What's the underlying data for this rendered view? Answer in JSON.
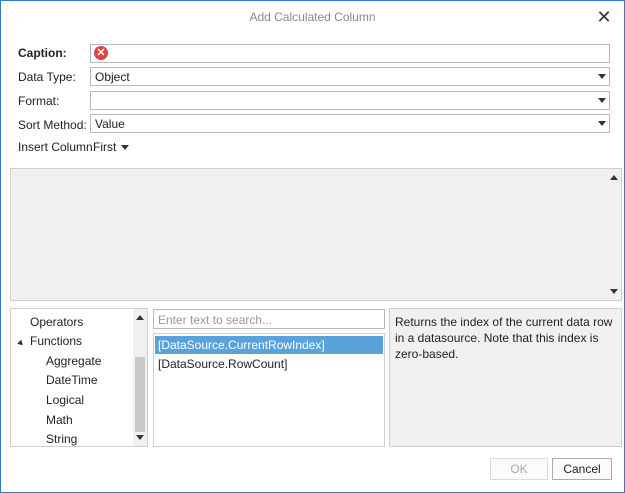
{
  "dialog": {
    "title": "Add Calculated Column",
    "close_glyph": "✕"
  },
  "form": {
    "caption_label": "Caption:",
    "caption_error_icon": "error-icon",
    "datatype_label": "Data Type:",
    "datatype_value": "Object",
    "format_label": "Format:",
    "format_value": "",
    "sort_label": "Sort Method:",
    "sort_value": "Value",
    "insert_label": "Insert Column:",
    "insert_value": "First"
  },
  "tree": {
    "items": [
      "Operators",
      "Functions",
      "Aggregate",
      "DateTime",
      "Logical",
      "Math",
      "String"
    ]
  },
  "search": {
    "placeholder": "Enter text to search..."
  },
  "list": {
    "items": [
      "[DataSource.CurrentRowIndex]",
      "[DataSource.RowCount]"
    ],
    "selected_index": 0
  },
  "description": "Returns the index of the current data row in a datasource. Note that this index is zero-based.",
  "buttons": {
    "ok": "OK",
    "cancel": "Cancel"
  },
  "colors": {
    "accent_border": "#2b7bd6",
    "selection": "#5aa2dc",
    "error": "#e04343"
  }
}
